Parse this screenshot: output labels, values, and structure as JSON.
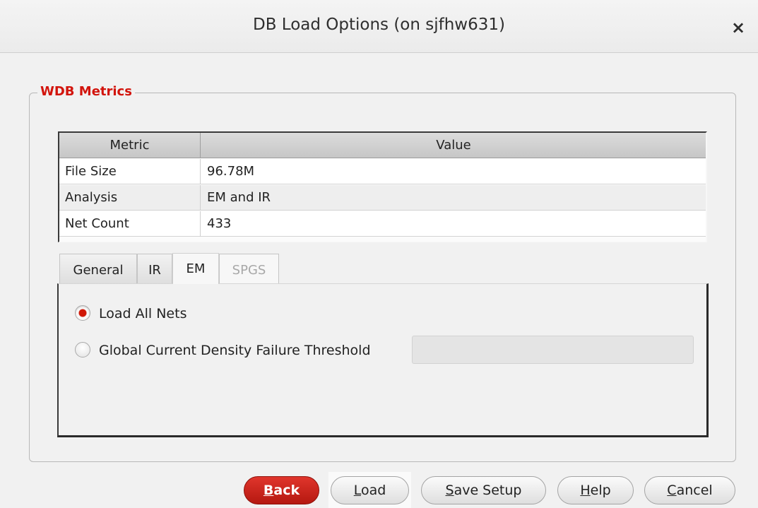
{
  "window": {
    "title": "DB Load Options (on sjfhw631)",
    "close_glyph": "×"
  },
  "group": {
    "title": "WDB Metrics"
  },
  "table": {
    "headers": [
      "Metric",
      "Value"
    ],
    "rows": [
      {
        "metric": "File Size",
        "value": "96.78M"
      },
      {
        "metric": "Analysis",
        "value": "EM and IR"
      },
      {
        "metric": "Net Count",
        "value": "433"
      }
    ]
  },
  "tabs": [
    {
      "label": "General",
      "state": "normal"
    },
    {
      "label": "IR",
      "state": "normal"
    },
    {
      "label": "EM",
      "state": "active"
    },
    {
      "label": "SPGS",
      "state": "disabled"
    }
  ],
  "em_panel": {
    "load_all_nets": {
      "label": "Load All Nets",
      "selected": true
    },
    "threshold": {
      "label": "Global Current Density Failure Threshold",
      "selected": false,
      "value": ""
    }
  },
  "buttons": {
    "back": {
      "mnemonic": "B",
      "rest": "ack"
    },
    "load": {
      "mnemonic": "L",
      "rest": "oad"
    },
    "save_setup": {
      "mnemonic": "S",
      "rest": "ave Setup"
    },
    "help": {
      "mnemonic": "H",
      "rest": "elp"
    },
    "cancel": {
      "mnemonic": "C",
      "rest": "ancel"
    }
  },
  "colors": {
    "accent": "#d2140c",
    "primary_button": "#c9241b"
  }
}
